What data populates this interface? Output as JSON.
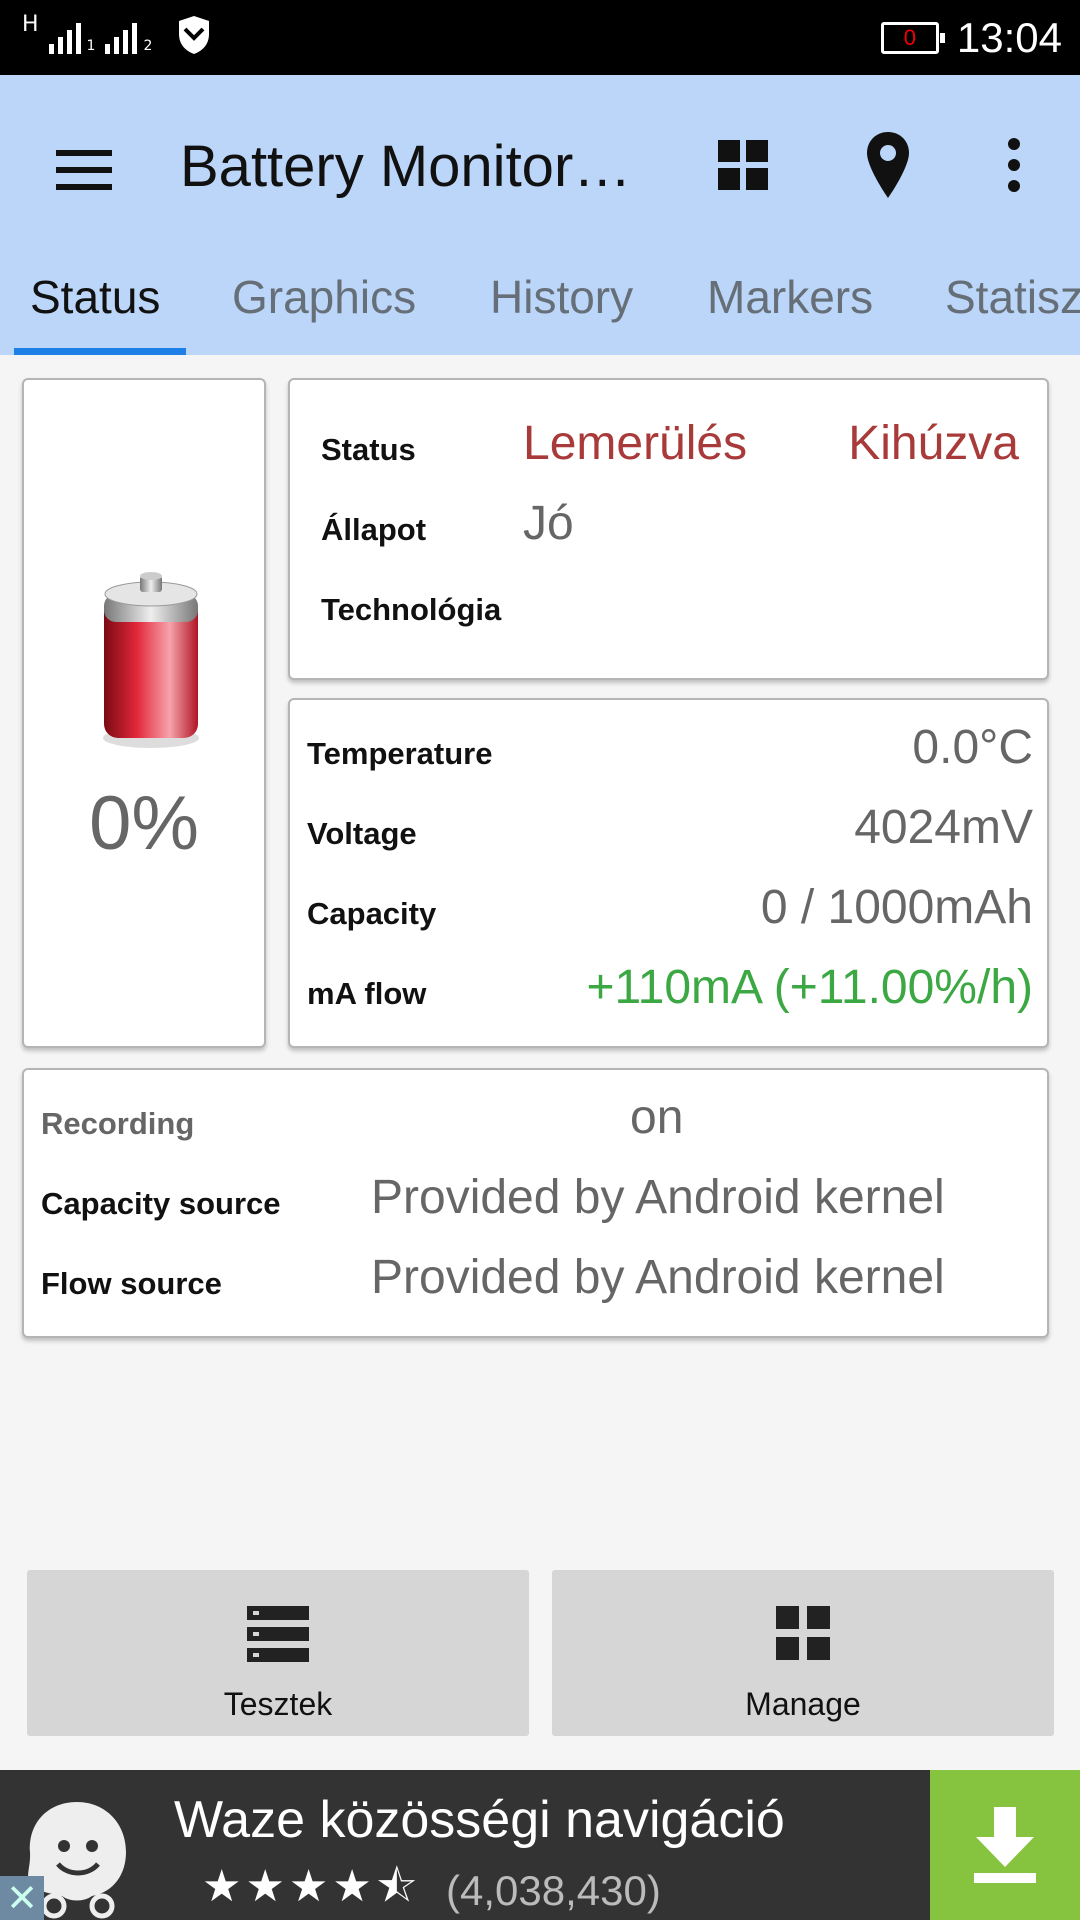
{
  "status_bar": {
    "network": "H",
    "sim1": "1",
    "sim2": "2",
    "battery_level": "0",
    "time": "13:04"
  },
  "app_bar": {
    "title": "Battery Monitor…",
    "icons": [
      "menu-icon",
      "widgets-grid-icon",
      "location-pin-icon",
      "more-vert-icon"
    ]
  },
  "tabs": [
    {
      "label": "Status",
      "active": true
    },
    {
      "label": "Graphics"
    },
    {
      "label": "History"
    },
    {
      "label": "Markers"
    },
    {
      "label": "Statisz"
    }
  ],
  "battery": {
    "percent_label": "0%",
    "level": 0.0
  },
  "status_card": {
    "status_label": "Status",
    "status_value": "Lemerülés",
    "plug_value": "Kihúzva",
    "health_label": "Állapot",
    "health_value": "Jó",
    "technology_label": "Technológia",
    "technology_value": ""
  },
  "metrics_card": {
    "temperature_label": "Temperature",
    "temperature_value": "0.0°C",
    "voltage_label": "Voltage",
    "voltage_value": "4024mV",
    "capacity_label": "Capacity",
    "capacity_value": "0 / 1000mAh",
    "flow_label": "mA flow",
    "flow_value": "+110mA (+11.00%/h)"
  },
  "recording_card": {
    "recording_label": "Recording",
    "recording_value": "on",
    "capacity_source_label": "Capacity source",
    "capacity_source_value": "Provided by Android kernel",
    "flow_source_label": "Flow source",
    "flow_source_value": "Provided by Android kernel"
  },
  "buttons": {
    "tests_label": "Tesztek",
    "manage_label": "Manage"
  },
  "ad": {
    "title": "Waze közösségi navigáció",
    "stars": "★★★★⯪",
    "rating": 4.5,
    "count": "(4,038,430)"
  },
  "colors": {
    "app_bar": "#bbd6f8",
    "tab_indicator": "#1e7fe6",
    "status_red": "#a93a3a",
    "flow_green": "#3ca843",
    "ad_download": "#86c440"
  }
}
